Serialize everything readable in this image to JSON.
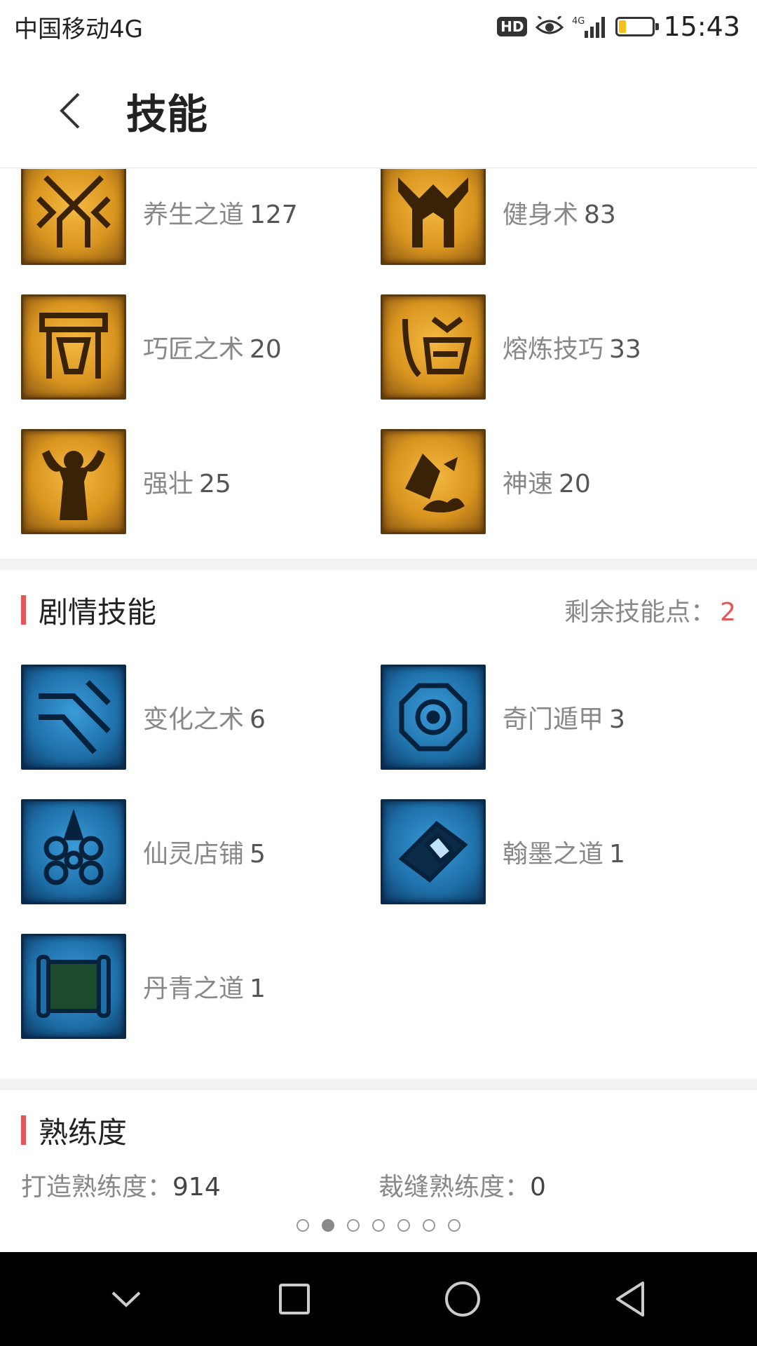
{
  "status": {
    "carrier": "中国移动4G",
    "hd": "HD",
    "network": "4G",
    "time": "15:43",
    "battery_level": 0.2
  },
  "header": {
    "title": "技能",
    "back_icon": "chevron-left-icon"
  },
  "life_skills": [
    {
      "name": "养生之道",
      "level": "127"
    },
    {
      "name": "健身术",
      "level": "83"
    },
    {
      "name": "巧匠之术",
      "level": "20"
    },
    {
      "name": "熔炼技巧",
      "level": "33"
    },
    {
      "name": "强壮",
      "level": "25"
    },
    {
      "name": "神速",
      "level": "20"
    }
  ],
  "story_skills": {
    "title": "剧情技能",
    "points_label": "剩余技能点：",
    "points_value": "2",
    "items": [
      {
        "name": "变化之术",
        "level": "6"
      },
      {
        "name": "奇门遁甲",
        "level": "3"
      },
      {
        "name": "仙灵店铺",
        "level": "5"
      },
      {
        "name": "翰墨之道",
        "level": "1"
      },
      {
        "name": "丹青之道",
        "level": "1"
      }
    ]
  },
  "proficiency": {
    "title": "熟练度",
    "items": [
      {
        "label": "打造熟练度：",
        "value": "914"
      },
      {
        "label": "裁缝熟练度：",
        "value": "0"
      }
    ]
  },
  "pager": {
    "count": 7,
    "active": 2
  },
  "colors": {
    "accent": "#e55757",
    "gold_icon": "#e0a030",
    "blue_icon": "#2a86c8"
  }
}
